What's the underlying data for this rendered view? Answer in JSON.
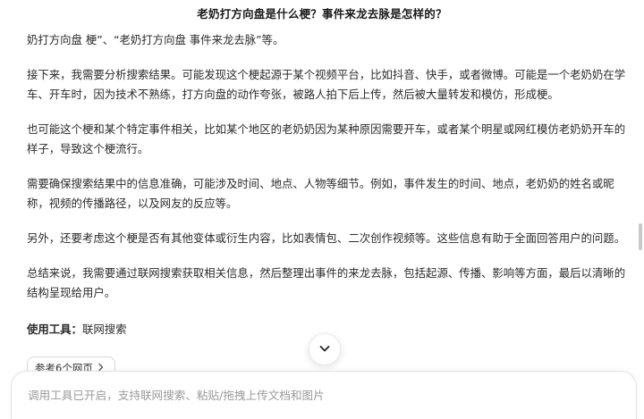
{
  "header": {
    "title": "老奶打方向盘是什么梗？事件来龙去脉是怎样的？"
  },
  "content": {
    "paragraphs": [
      "奶打方向盘 梗”、“老奶打方向盘 事件来龙去脉”等。",
      "接下来，我需要分析搜索结果。可能发现这个梗起源于某个视频平台，比如抖音、快手，或者微博。可能是一个老奶奶在学车、开车时，因为技术不熟练，打方向盘的动作夸张，被路人拍下后上传，然后被大量转发和模仿，形成梗。",
      "也可能这个梗和某个特定事件相关，比如某个地区的老奶奶因为某种原因需要开车，或者某个明星或网红模仿老奶奶开车的样子，导致这个梗流行。",
      "需要确保搜索结果中的信息准确，可能涉及时间、地点、人物等细节。例如，事件发生的时间、地点，老奶奶的姓名或昵称，视频的传播路径，以及网友的反应等。",
      "另外，还要考虑这个梗是否有其他变体或衍生内容，比如表情包、二次创作视频等。这些信息有助于全面回答用户的问题。",
      "总结来说，我需要通过联网搜索获取相关信息，然后整理出事件的来龙去脉，包括起源、传播、影响等方面，最后以清晰的结构呈现给用户。"
    ],
    "tool_key": "使用工具：",
    "tool_value": "联网搜索"
  },
  "refs": {
    "label": "参考6个网页"
  },
  "input": {
    "placeholder": "调用工具已开启，支持联网搜索、粘贴/拖拽上传文档和图片"
  },
  "icons": {
    "scroll_down": "chevron-down-icon",
    "refs_arrow": "chevron-right-icon"
  }
}
